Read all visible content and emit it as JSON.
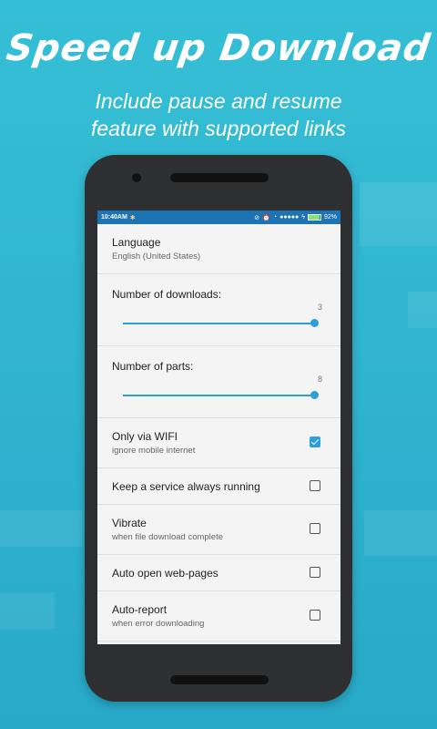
{
  "hero": {
    "title": "Speed up Download",
    "subtitle_line1": "Include pause and resume",
    "subtitle_line2": "feature with supported links"
  },
  "statusbar": {
    "time": "10:40AM",
    "notification_icon": "bug-icon",
    "signal_dots": "●●●●●",
    "battery_percent": "92%",
    "battery_level": 0.92
  },
  "settings": {
    "language": {
      "title": "Language",
      "value": "English (United States)"
    },
    "downloads": {
      "title": "Number of downloads:",
      "value": "3",
      "level": 1.0
    },
    "parts": {
      "title": "Number of parts:",
      "value": "8",
      "level": 1.0
    },
    "wifi": {
      "title": "Only via WIFI",
      "summary": "ignore mobile internet",
      "checked": true
    },
    "service": {
      "title": "Keep a service always running",
      "checked": false
    },
    "vibrate": {
      "title": "Vibrate",
      "summary": "when file download complete",
      "checked": false
    },
    "autoopen": {
      "title": "Auto open web-pages",
      "checked": false
    },
    "autoreport": {
      "title": "Auto-report",
      "summary": "when error downloading",
      "checked": false
    }
  },
  "colors": {
    "accent": "#2a9fd9",
    "statusbar": "#1d74b4",
    "background": "#35bfd6"
  }
}
